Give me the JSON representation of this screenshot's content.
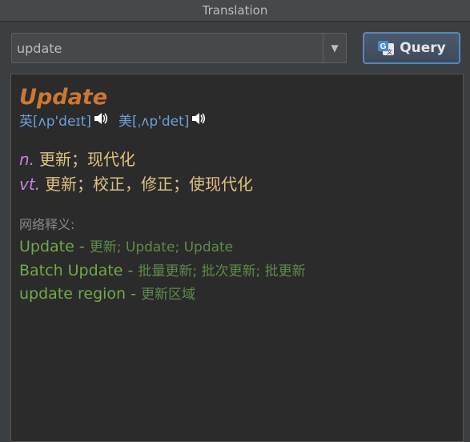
{
  "window": {
    "title": "Translation"
  },
  "search": {
    "value": "update"
  },
  "query_button": {
    "label": "Query",
    "icon": "translate-icon"
  },
  "result": {
    "word": "Update",
    "phonetics": [
      {
        "text": "英[ʌp'deɪt]",
        "icon": "speaker-icon"
      },
      {
        "text": "美[ˌʌp'det]",
        "icon": "speaker-icon"
      }
    ],
    "definitions": [
      {
        "pos": "n.",
        "meaning": "更新；现代化"
      },
      {
        "pos": "vt.",
        "meaning": "更新；校正，修正；使现代化"
      }
    ],
    "web_heading": "网络释义:",
    "web": [
      {
        "term": "Update",
        "sep": " - ",
        "meaning": "更新; Update; Update"
      },
      {
        "term": "Batch Update",
        "sep": " - ",
        "meaning": "批量更新; 批次更新; 批更新"
      },
      {
        "term": "update region",
        "sep": " - ",
        "meaning": "更新区域"
      }
    ]
  },
  "colors": {
    "word": "#cc7832",
    "phonetic": "#6a9fd8",
    "pos": "#c77fe0",
    "definition": "#e0c080",
    "web_term": "#71a84a",
    "button_border": "#5a86b8"
  }
}
